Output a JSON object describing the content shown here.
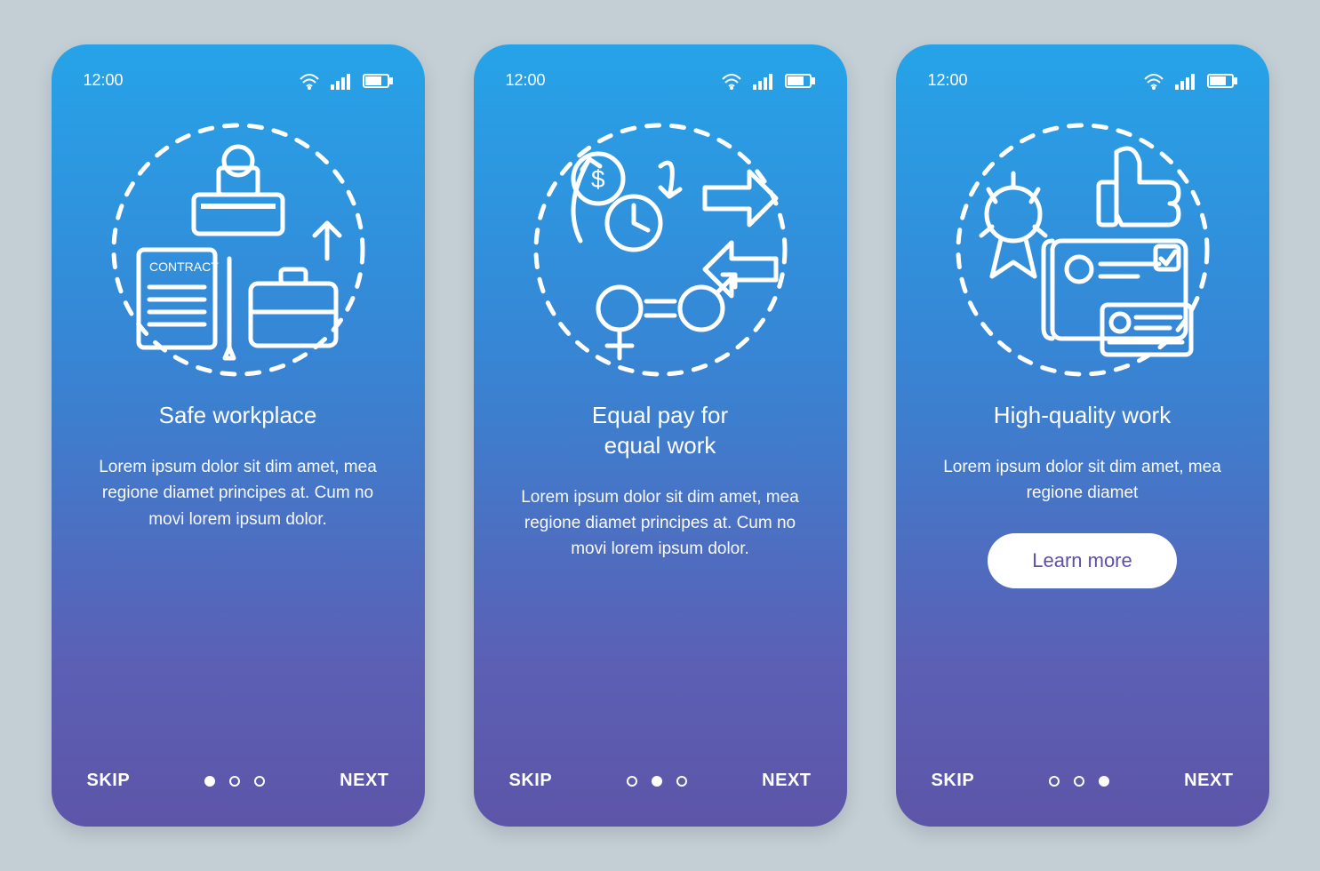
{
  "status": {
    "time": "12:00",
    "wifi_icon": "wifi-icon",
    "signal_icon": "signal-icon",
    "battery_icon": "battery-icon"
  },
  "nav": {
    "skip": "SKIP",
    "next": "NEXT",
    "learn_more": "Learn more"
  },
  "screens": [
    {
      "title": "Safe workplace",
      "body": "Lorem ipsum dolor sit dim amet, mea regione diamet principes at. Cum no movi lorem ipsum dolor.",
      "illustration": "safe-workplace-illustration",
      "active_dot": 0,
      "cta": false,
      "icon_labels": {
        "contract": "CONTRACT"
      }
    },
    {
      "title": "Equal pay for\nequal work",
      "body": "Lorem ipsum dolor sit dim amet, mea regione diamet principes at. Cum no movi lorem ipsum dolor.",
      "illustration": "equal-pay-illustration",
      "active_dot": 1,
      "cta": false
    },
    {
      "title": "High-quality work",
      "body": "Lorem ipsum dolor sit dim amet, mea regione diamet",
      "illustration": "quality-work-illustration",
      "active_dot": 2,
      "cta": true
    }
  ]
}
